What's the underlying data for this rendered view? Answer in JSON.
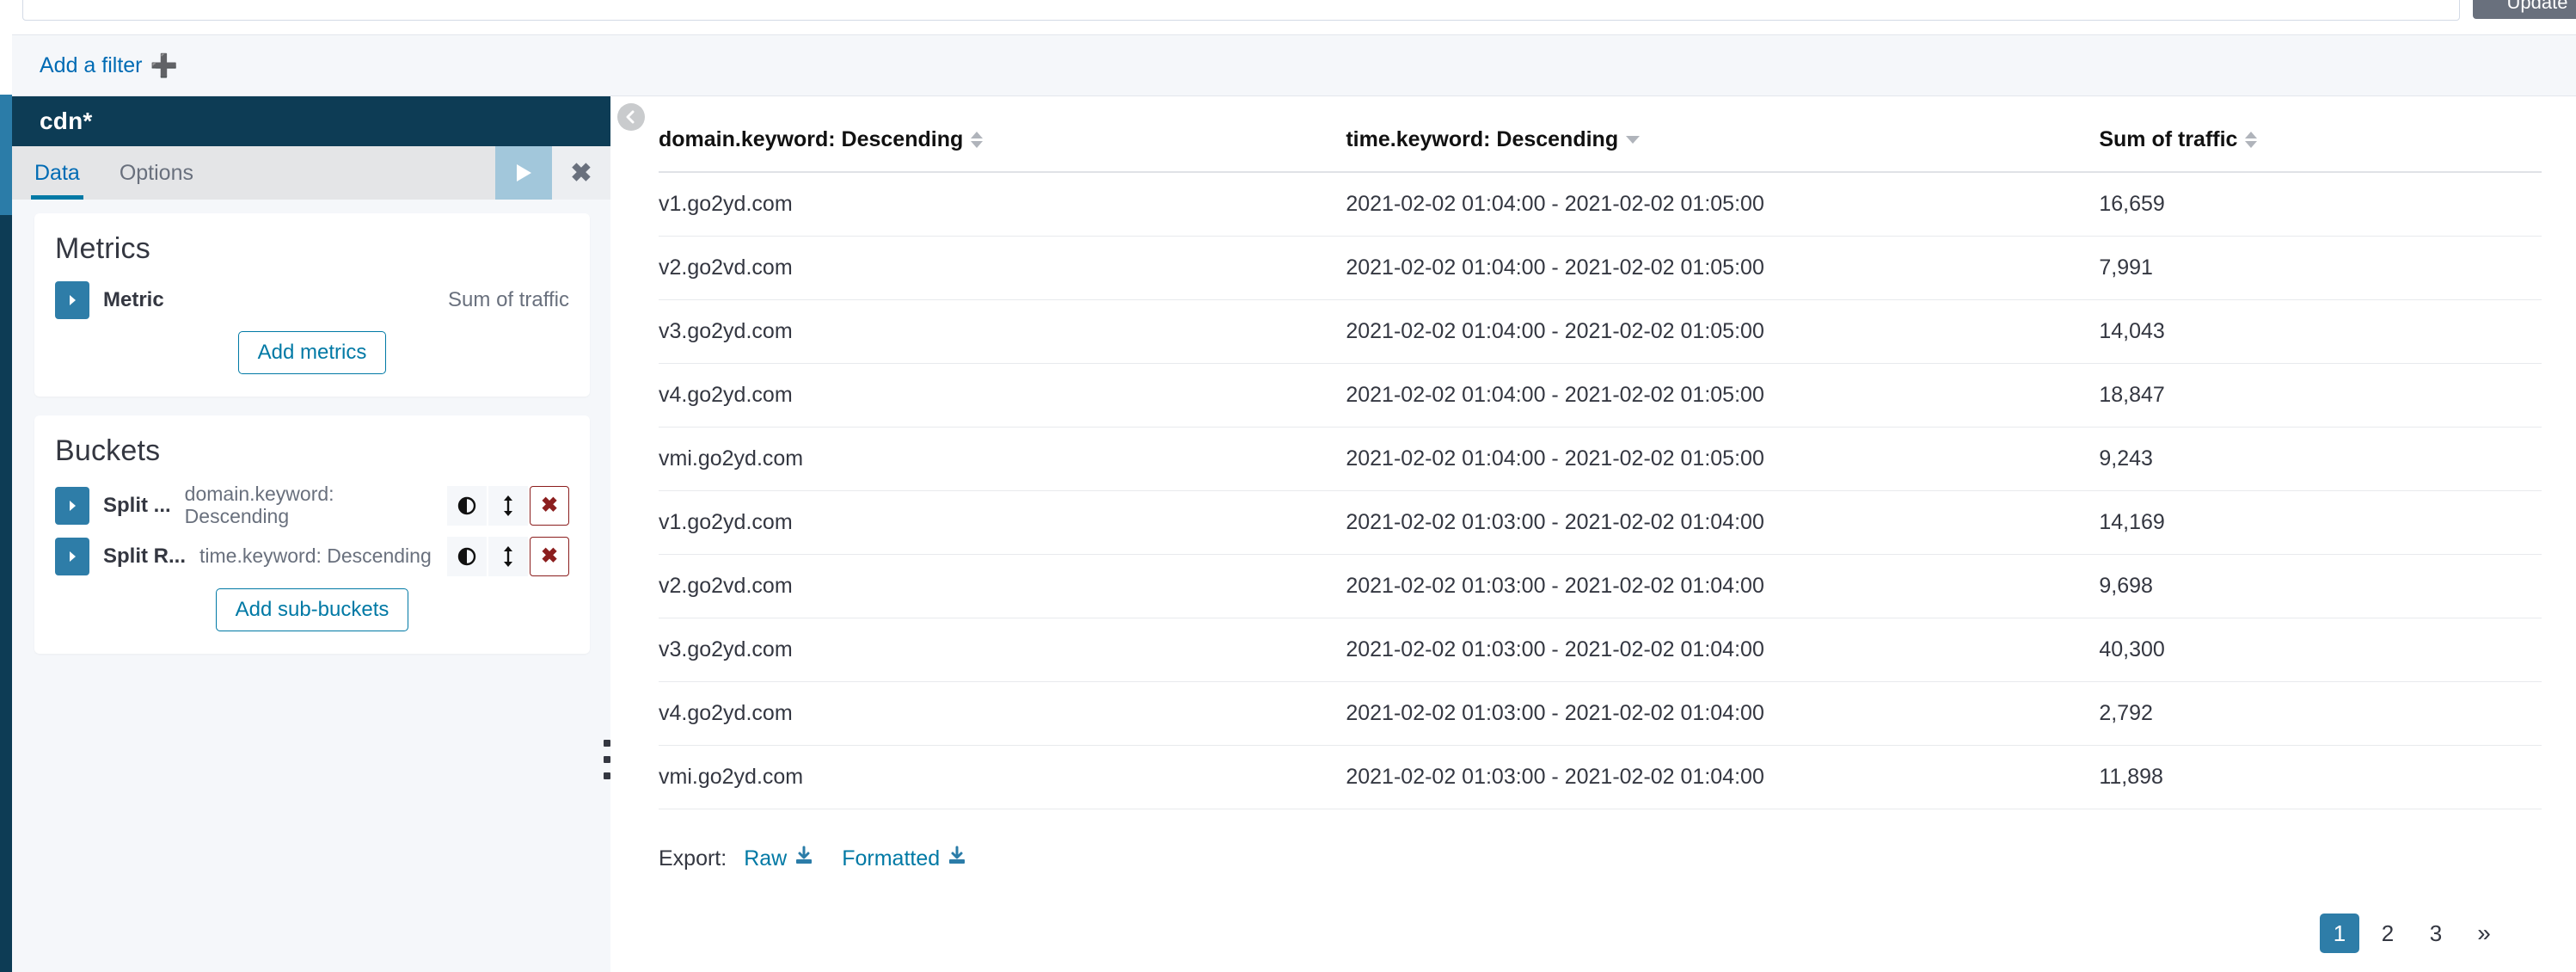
{
  "query_bar": {
    "value": "",
    "placeholder": "",
    "update_label": "Update"
  },
  "filter_bar": {
    "add_filter_label": "Add a filter",
    "plus_icon": "plus-icon"
  },
  "sidebar": {
    "index_pattern": "cdn*",
    "tabs": [
      {
        "label": "Data",
        "active": true
      },
      {
        "label": "Options",
        "active": false
      }
    ],
    "apply_icon": "play-icon",
    "cancel_icon": "close-icon",
    "metrics": {
      "title": "Metrics",
      "rows": [
        {
          "label": "Metric",
          "value": "Sum of traffic",
          "expand_icon": "chevron-right-icon"
        }
      ],
      "add_button": "Add metrics"
    },
    "buckets": {
      "title": "Buckets",
      "rows": [
        {
          "label": "Split ...",
          "value": "domain.keyword: Descending",
          "expand_icon": "chevron-right-icon",
          "toggle_icon": "visibility-toggle-icon",
          "move_icon": "move-updown-icon",
          "remove_icon": "remove-x-icon"
        },
        {
          "label": "Split R...",
          "value": "time.keyword: Descending",
          "expand_icon": "chevron-right-icon",
          "toggle_icon": "visibility-toggle-icon",
          "move_icon": "move-updown-icon",
          "remove_icon": "remove-x-icon"
        }
      ],
      "add_button": "Add sub-buckets"
    }
  },
  "splitter": {
    "collapse_icon": "chevron-left-icon",
    "drag_icon": "drag-handle-icon"
  },
  "table": {
    "columns": [
      {
        "label": "domain.keyword: Descending",
        "sort": "none"
      },
      {
        "label": "time.keyword: Descending",
        "sort": "desc"
      },
      {
        "label": "Sum of traffic",
        "sort": "none"
      }
    ],
    "rows": [
      {
        "domain": "v1.go2yd.com",
        "time": "2021-02-02 01:04:00 - 2021-02-02 01:05:00",
        "traffic": "16,659"
      },
      {
        "domain": "v2.go2vd.com",
        "time": "2021-02-02 01:04:00 - 2021-02-02 01:05:00",
        "traffic": "7,991"
      },
      {
        "domain": "v3.go2yd.com",
        "time": "2021-02-02 01:04:00 - 2021-02-02 01:05:00",
        "traffic": "14,043"
      },
      {
        "domain": "v4.go2yd.com",
        "time": "2021-02-02 01:04:00 - 2021-02-02 01:05:00",
        "traffic": "18,847"
      },
      {
        "domain": "vmi.go2yd.com",
        "time": "2021-02-02 01:04:00 - 2021-02-02 01:05:00",
        "traffic": "9,243"
      },
      {
        "domain": "v1.go2yd.com",
        "time": "2021-02-02 01:03:00 - 2021-02-02 01:04:00",
        "traffic": "14,169"
      },
      {
        "domain": "v2.go2vd.com",
        "time": "2021-02-02 01:03:00 - 2021-02-02 01:04:00",
        "traffic": "9,698"
      },
      {
        "domain": "v3.go2yd.com",
        "time": "2021-02-02 01:03:00 - 2021-02-02 01:04:00",
        "traffic": "40,300"
      },
      {
        "domain": "v4.go2yd.com",
        "time": "2021-02-02 01:03:00 - 2021-02-02 01:04:00",
        "traffic": "2,792"
      },
      {
        "domain": "vmi.go2yd.com",
        "time": "2021-02-02 01:03:00 - 2021-02-02 01:04:00",
        "traffic": "11,898"
      }
    ]
  },
  "export": {
    "label": "Export:",
    "raw_label": "Raw",
    "formatted_label": "Formatted",
    "download_icon": "download-icon"
  },
  "pagination": {
    "pages": [
      "1",
      "2",
      "3"
    ],
    "active_page": "1",
    "next_label": "»"
  },
  "colors": {
    "accent_blue": "#0079a5",
    "header_navy": "#0d3c55",
    "active_page_blue": "#2e7da8",
    "danger_red": "#8b1e1e",
    "link_blue": "#006bb4"
  }
}
